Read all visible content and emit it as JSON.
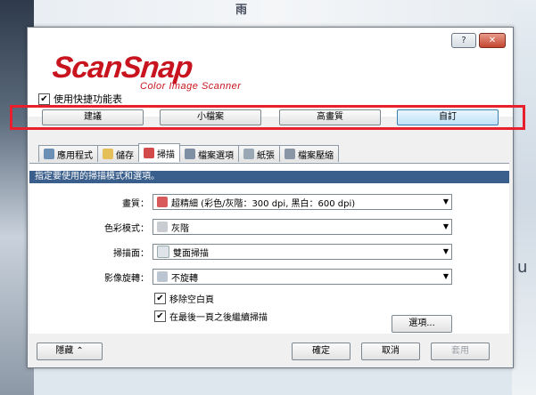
{
  "background": {
    "top_char": "雨",
    "right_char": "u"
  },
  "window": {
    "help_label": "?",
    "close_label": "✕",
    "logo_main": "ScanSnap",
    "logo_sub": "Color Image Scanner"
  },
  "quick_menu": {
    "checked": true,
    "label": "使用快捷功能表"
  },
  "presets": [
    {
      "label": "建議"
    },
    {
      "label": "小檔案"
    },
    {
      "label": "高畫質"
    },
    {
      "label": "自訂"
    }
  ],
  "tabs": [
    {
      "label": "應用程式",
      "icon": "application-icon",
      "color": "#6b8fb5"
    },
    {
      "label": "儲存",
      "icon": "folder-icon",
      "color": "#e5c05a"
    },
    {
      "label": "掃描",
      "icon": "scan-icon",
      "color": "#d24a4a"
    },
    {
      "label": "檔案選項",
      "icon": "file-options-icon",
      "color": "#7f8fa3"
    },
    {
      "label": "紙張",
      "icon": "paper-icon",
      "color": "#9aa7b5"
    },
    {
      "label": "檔案壓縮",
      "icon": "compression-icon",
      "color": "#8896a6"
    }
  ],
  "panel": {
    "hint": "指定要使用的掃描模式和選項。",
    "fields": [
      {
        "label": "畫質：",
        "value": "超精細 (彩色/灰階：300 dpi, 黑白：600 dpi)",
        "icon": "quality-icon",
        "color": "#d95a5a"
      },
      {
        "label": "色彩模式：",
        "value": "灰階",
        "icon": "color-mode-icon",
        "color": "#c9ccd0"
      },
      {
        "label": "掃描面：",
        "value": "雙面掃描",
        "icon": "duplex-icon",
        "color": "#dfe4ea"
      },
      {
        "label": "影像旋轉：",
        "value": "不旋轉",
        "icon": "rotate-icon",
        "color": "#bcc6d2"
      }
    ],
    "checkboxes": [
      {
        "label": "移除空白頁",
        "checked": true
      },
      {
        "label": "在最後一頁之後繼續掃描",
        "checked": true
      }
    ],
    "options_button": "選項..."
  },
  "bottom": {
    "hide_button": "隱藏",
    "ok_button": "確定",
    "cancel_button": "取消",
    "apply_button": "套用"
  }
}
